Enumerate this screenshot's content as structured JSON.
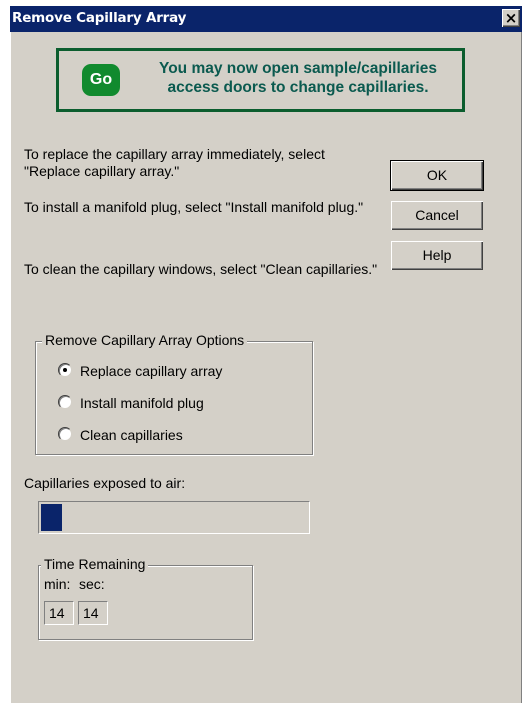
{
  "window": {
    "title": "Remove Capillary Array",
    "close_glyph": "×"
  },
  "notice": {
    "badge": "Go",
    "message": "You may now open sample/capillaries access doors to change capillaries.",
    "border_color": "#0b5d2e",
    "badge_color": "#118a2e",
    "text_color": "#0b5a4f"
  },
  "instructions": [
    "To replace the capillary array immediately, select \"Replace capillary array.\"",
    "To install a manifold plug, select \"Install manifold plug.\"",
    "To clean the capillary windows, select \"Clean capillaries.\""
  ],
  "buttons": {
    "ok": "OK",
    "cancel": "Cancel",
    "help": "Help"
  },
  "options": {
    "legend": "Remove Capillary Array Options",
    "items": [
      "Replace capillary array",
      "Install manifold plug",
      "Clean capillaries"
    ],
    "selected_index": 0
  },
  "exposure": {
    "label": "Capillaries exposed to air:",
    "progress_fraction": 0.08,
    "bar_color": "#0a246a"
  },
  "time_remaining": {
    "legend": "Time Remaining",
    "min_label": "min:",
    "sec_label": "sec:",
    "minutes": "14",
    "seconds": "14"
  },
  "colors": {
    "titlebar": "#0a246a",
    "face": "#d4d0c8"
  }
}
